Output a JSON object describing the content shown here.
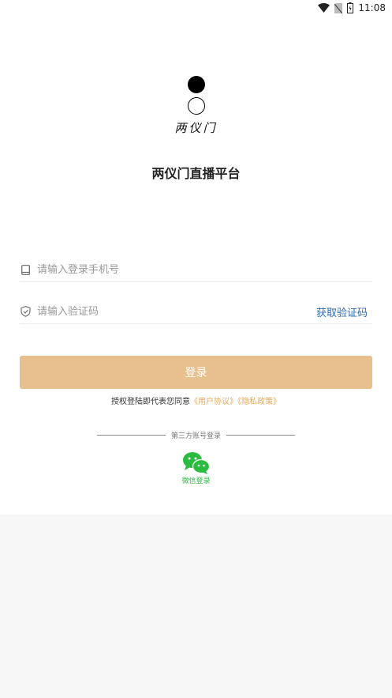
{
  "status_bar": {
    "time": "11:08",
    "icons": [
      "wifi-icon",
      "no-sim-icon",
      "battery-icon"
    ]
  },
  "logo": {
    "text": "两仪门"
  },
  "app_title": "两仪门直播平台",
  "phone_field": {
    "placeholder": "请输入登录手机号",
    "value": "",
    "icon": "phone-icon"
  },
  "code_field": {
    "placeholder": "请输入验证码",
    "value": "",
    "icon": "shield-check-icon",
    "get_code_label": "获取验证码"
  },
  "login_button": "登录",
  "agreement": {
    "prefix": "授权登陆即代表您同意",
    "user_agreement": "《用户协议》",
    "privacy_policy": "《隐私政策》"
  },
  "third_party": {
    "divider_label": "第三方账号登录",
    "wechat_label": "微信登录",
    "wechat_icon": "wechat-icon"
  },
  "colors": {
    "button_bg": "#e8c08f",
    "link": "#e6a75c",
    "get_code": "#2b6cb0",
    "wechat": "#2bbb3f"
  }
}
